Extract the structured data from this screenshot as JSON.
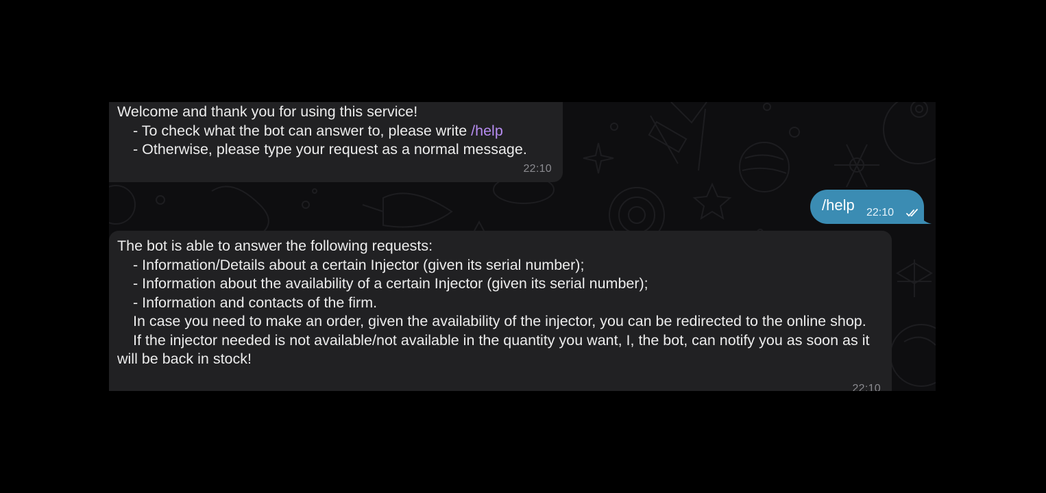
{
  "messages": {
    "welcome": {
      "lines": [
        "Welcome and thank you for using this service!",
        "- To check what the bot can answer to, please write ",
        "- Otherwise, please type your request as a normal message."
      ],
      "command": "/help",
      "time": "22:10"
    },
    "outgoing": {
      "text": "/help",
      "time": "22:10",
      "status_icon": "double-check-icon"
    },
    "requests": {
      "lines": [
        "The bot is able to answer the following requests:",
        "- Information/Details about a certain Injector (given its serial number);",
        "- Information about the availability of a certain Injector (given its serial number);",
        "- Information and contacts of the firm.",
        "In case you need to make an order, given the availability of the injector, you can be redirected to the online shop.",
        "If the injector needed is not available/not available in the quantity you want, I, the bot, can notify you as soon as it will be back in stock!"
      ],
      "time": "22:10"
    }
  },
  "colors": {
    "incoming_bubble": "#212123",
    "outgoing_bubble": "#3b8cb3",
    "command_link": "#b68cf0",
    "chat_background": "#0e0e10"
  },
  "background_pattern": "space-doodles"
}
